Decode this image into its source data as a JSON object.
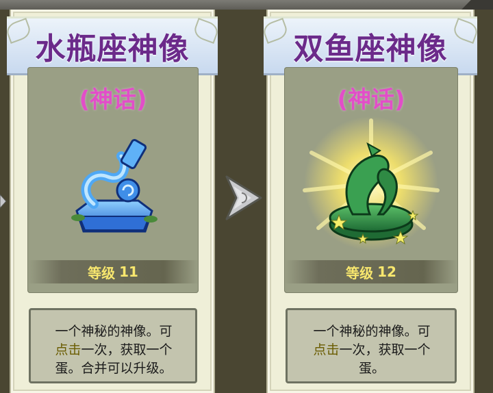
{
  "cards": [
    {
      "title": "水瓶座神像",
      "rarity": "(神话)",
      "level_label": "等级",
      "level_value": "11",
      "description_line1": "一个神秘的神像。可",
      "description_highlight": "点击",
      "description_line2_rest": "一次，获取一个",
      "description_line3": "蛋。合并可以升级。",
      "statue_icon": "aquarius-statue"
    },
    {
      "title": "双鱼座神像",
      "rarity": "(神话)",
      "level_label": "等级",
      "level_value": "12",
      "description_line1": "一个神秘的神像。可",
      "description_highlight": "点击",
      "description_line2_rest": "一次，获取一个",
      "description_line3": "蛋。",
      "statue_icon": "pisces-statue"
    }
  ],
  "colors": {
    "title": "#6b2a8a",
    "rarity": "#e24ec8",
    "level": "#f8e76e"
  }
}
